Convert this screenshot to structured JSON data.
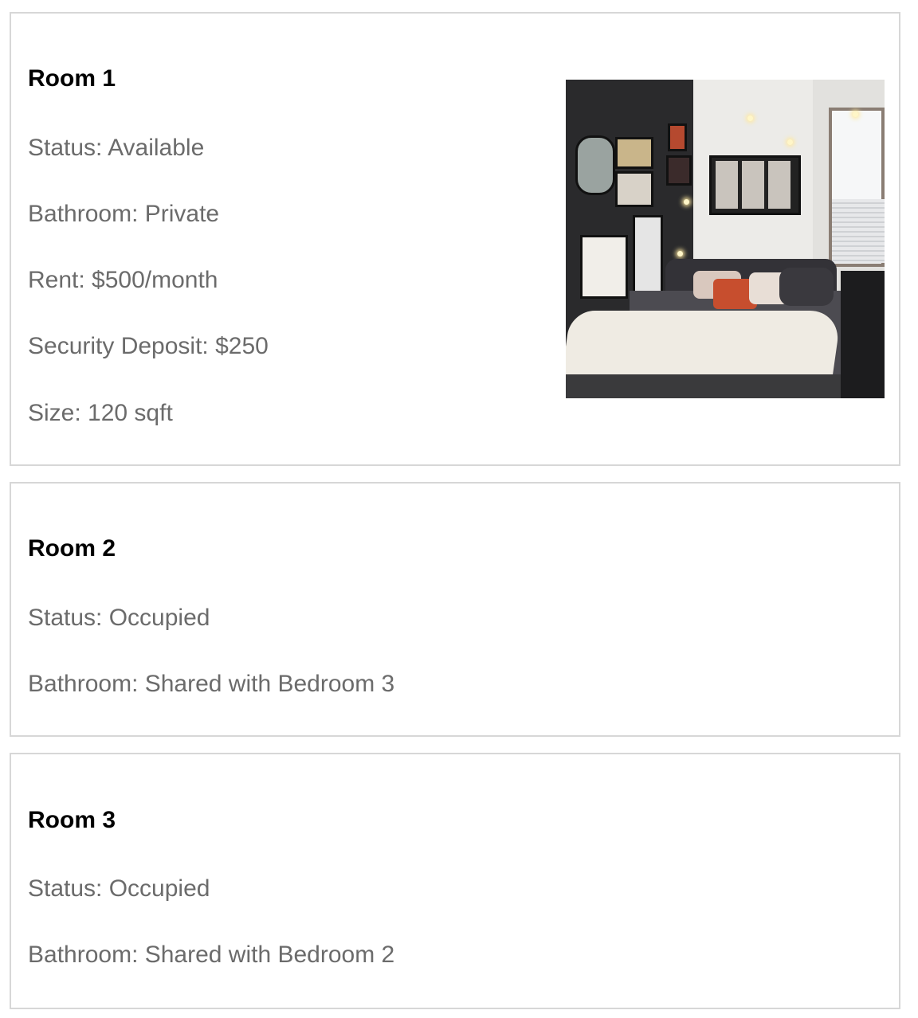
{
  "rooms": [
    {
      "title": "Room 1",
      "fields": [
        "Status: Available",
        "Bathroom: Private",
        "Rent: $500/month",
        "Security Deposit: $250",
        "Size: 120 sqft"
      ],
      "has_image": true
    },
    {
      "title": "Room 2",
      "fields": [
        "Status: Occupied",
        "Bathroom: Shared with Bedroom 3"
      ],
      "has_image": false
    },
    {
      "title": "Room 3",
      "fields": [
        "Status: Occupied",
        "Bathroom: Shared with Bedroom 2"
      ],
      "has_image": false
    }
  ],
  "colors": {
    "title": "#000000",
    "field_text": "#6b6b6b",
    "card_border": "#d7d7d7"
  }
}
